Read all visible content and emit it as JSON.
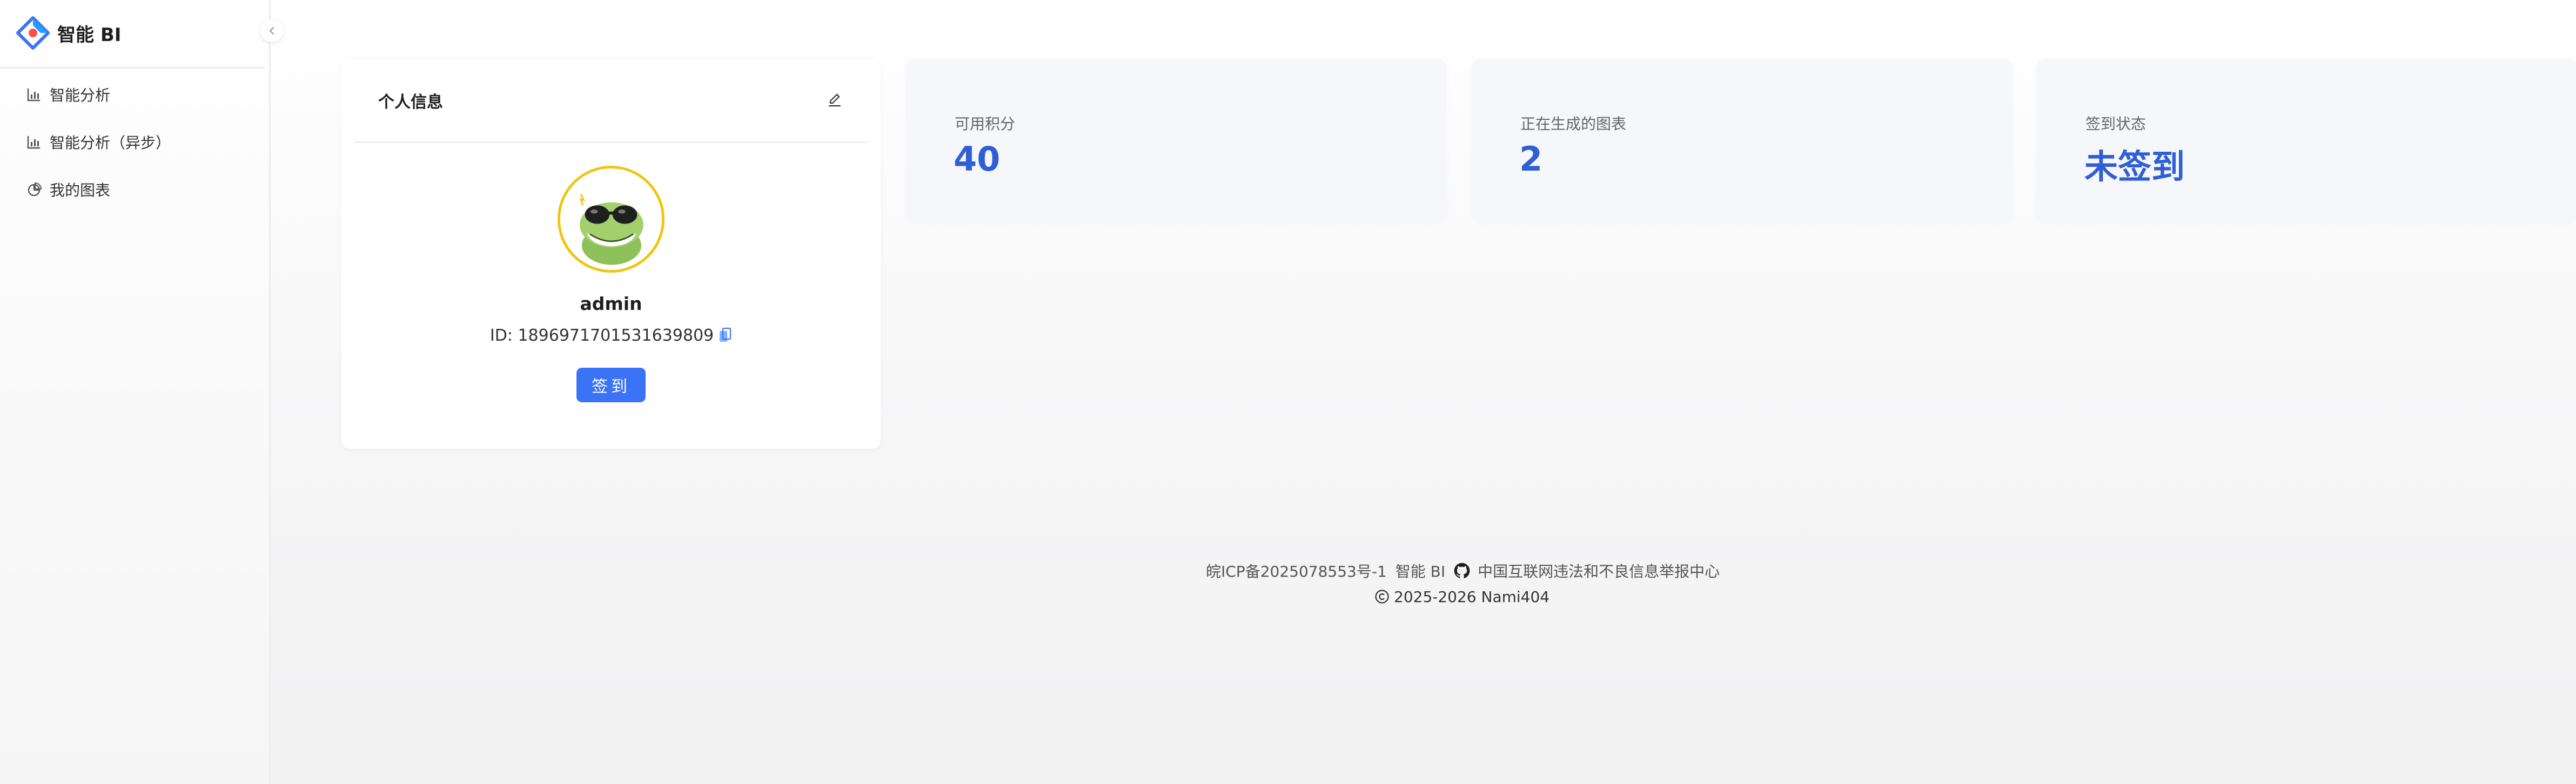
{
  "app": {
    "title": "智能 BI"
  },
  "sidebar": {
    "items": [
      {
        "label": "智能分析",
        "icon": "bar-chart-icon"
      },
      {
        "label": "智能分析（异步）",
        "icon": "bar-chart-icon"
      },
      {
        "label": "我的图表",
        "icon": "pie-chart-icon"
      }
    ]
  },
  "profile": {
    "title": "个人信息",
    "username": "admin",
    "id_text": "ID: 1896971701531639809",
    "signin_label": "签到"
  },
  "stats": [
    {
      "label": "可用积分",
      "value": "40"
    },
    {
      "label": "正在生成的图表",
      "value": "2"
    },
    {
      "label": "签到状态",
      "value": "未签到"
    }
  ],
  "footer": {
    "icp": "皖ICP备2025078553号-1",
    "brand": "智能 BI",
    "report_link": "中国互联网违法和不良信息举报中心",
    "copyright": "2025-2026 Nami404"
  },
  "colors": {
    "primary": "#3a73f5",
    "stat_value": "#2e5fd6",
    "avatar_border": "#f1c40f"
  }
}
